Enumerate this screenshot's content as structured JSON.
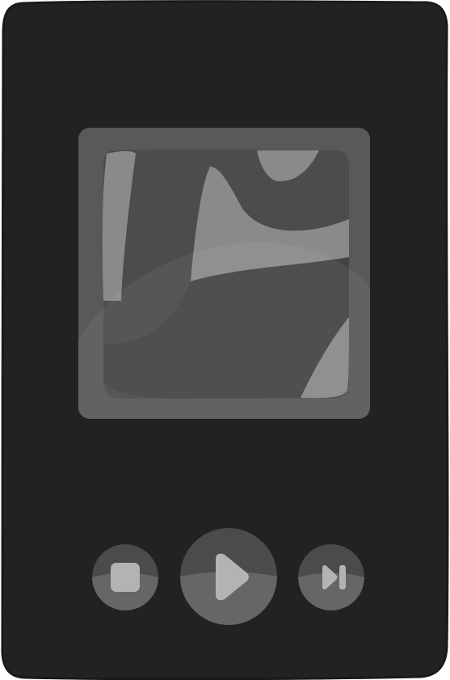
{
  "player": {
    "colors": {
      "background": "#ffffff",
      "body": "#222222",
      "art_frame": "#595959",
      "art_inner": "#4c4c4c",
      "art_highlight": "#8a8a8a",
      "button_top": "#4b4b4b",
      "button_bottom": "#666666",
      "glyph": "#b3b3b3"
    },
    "album_art": {
      "icon": "image-placeholder-icon"
    },
    "controls": {
      "stop": {
        "icon": "stop-icon"
      },
      "play": {
        "icon": "play-icon"
      },
      "next": {
        "icon": "skip-next-icon"
      }
    }
  }
}
